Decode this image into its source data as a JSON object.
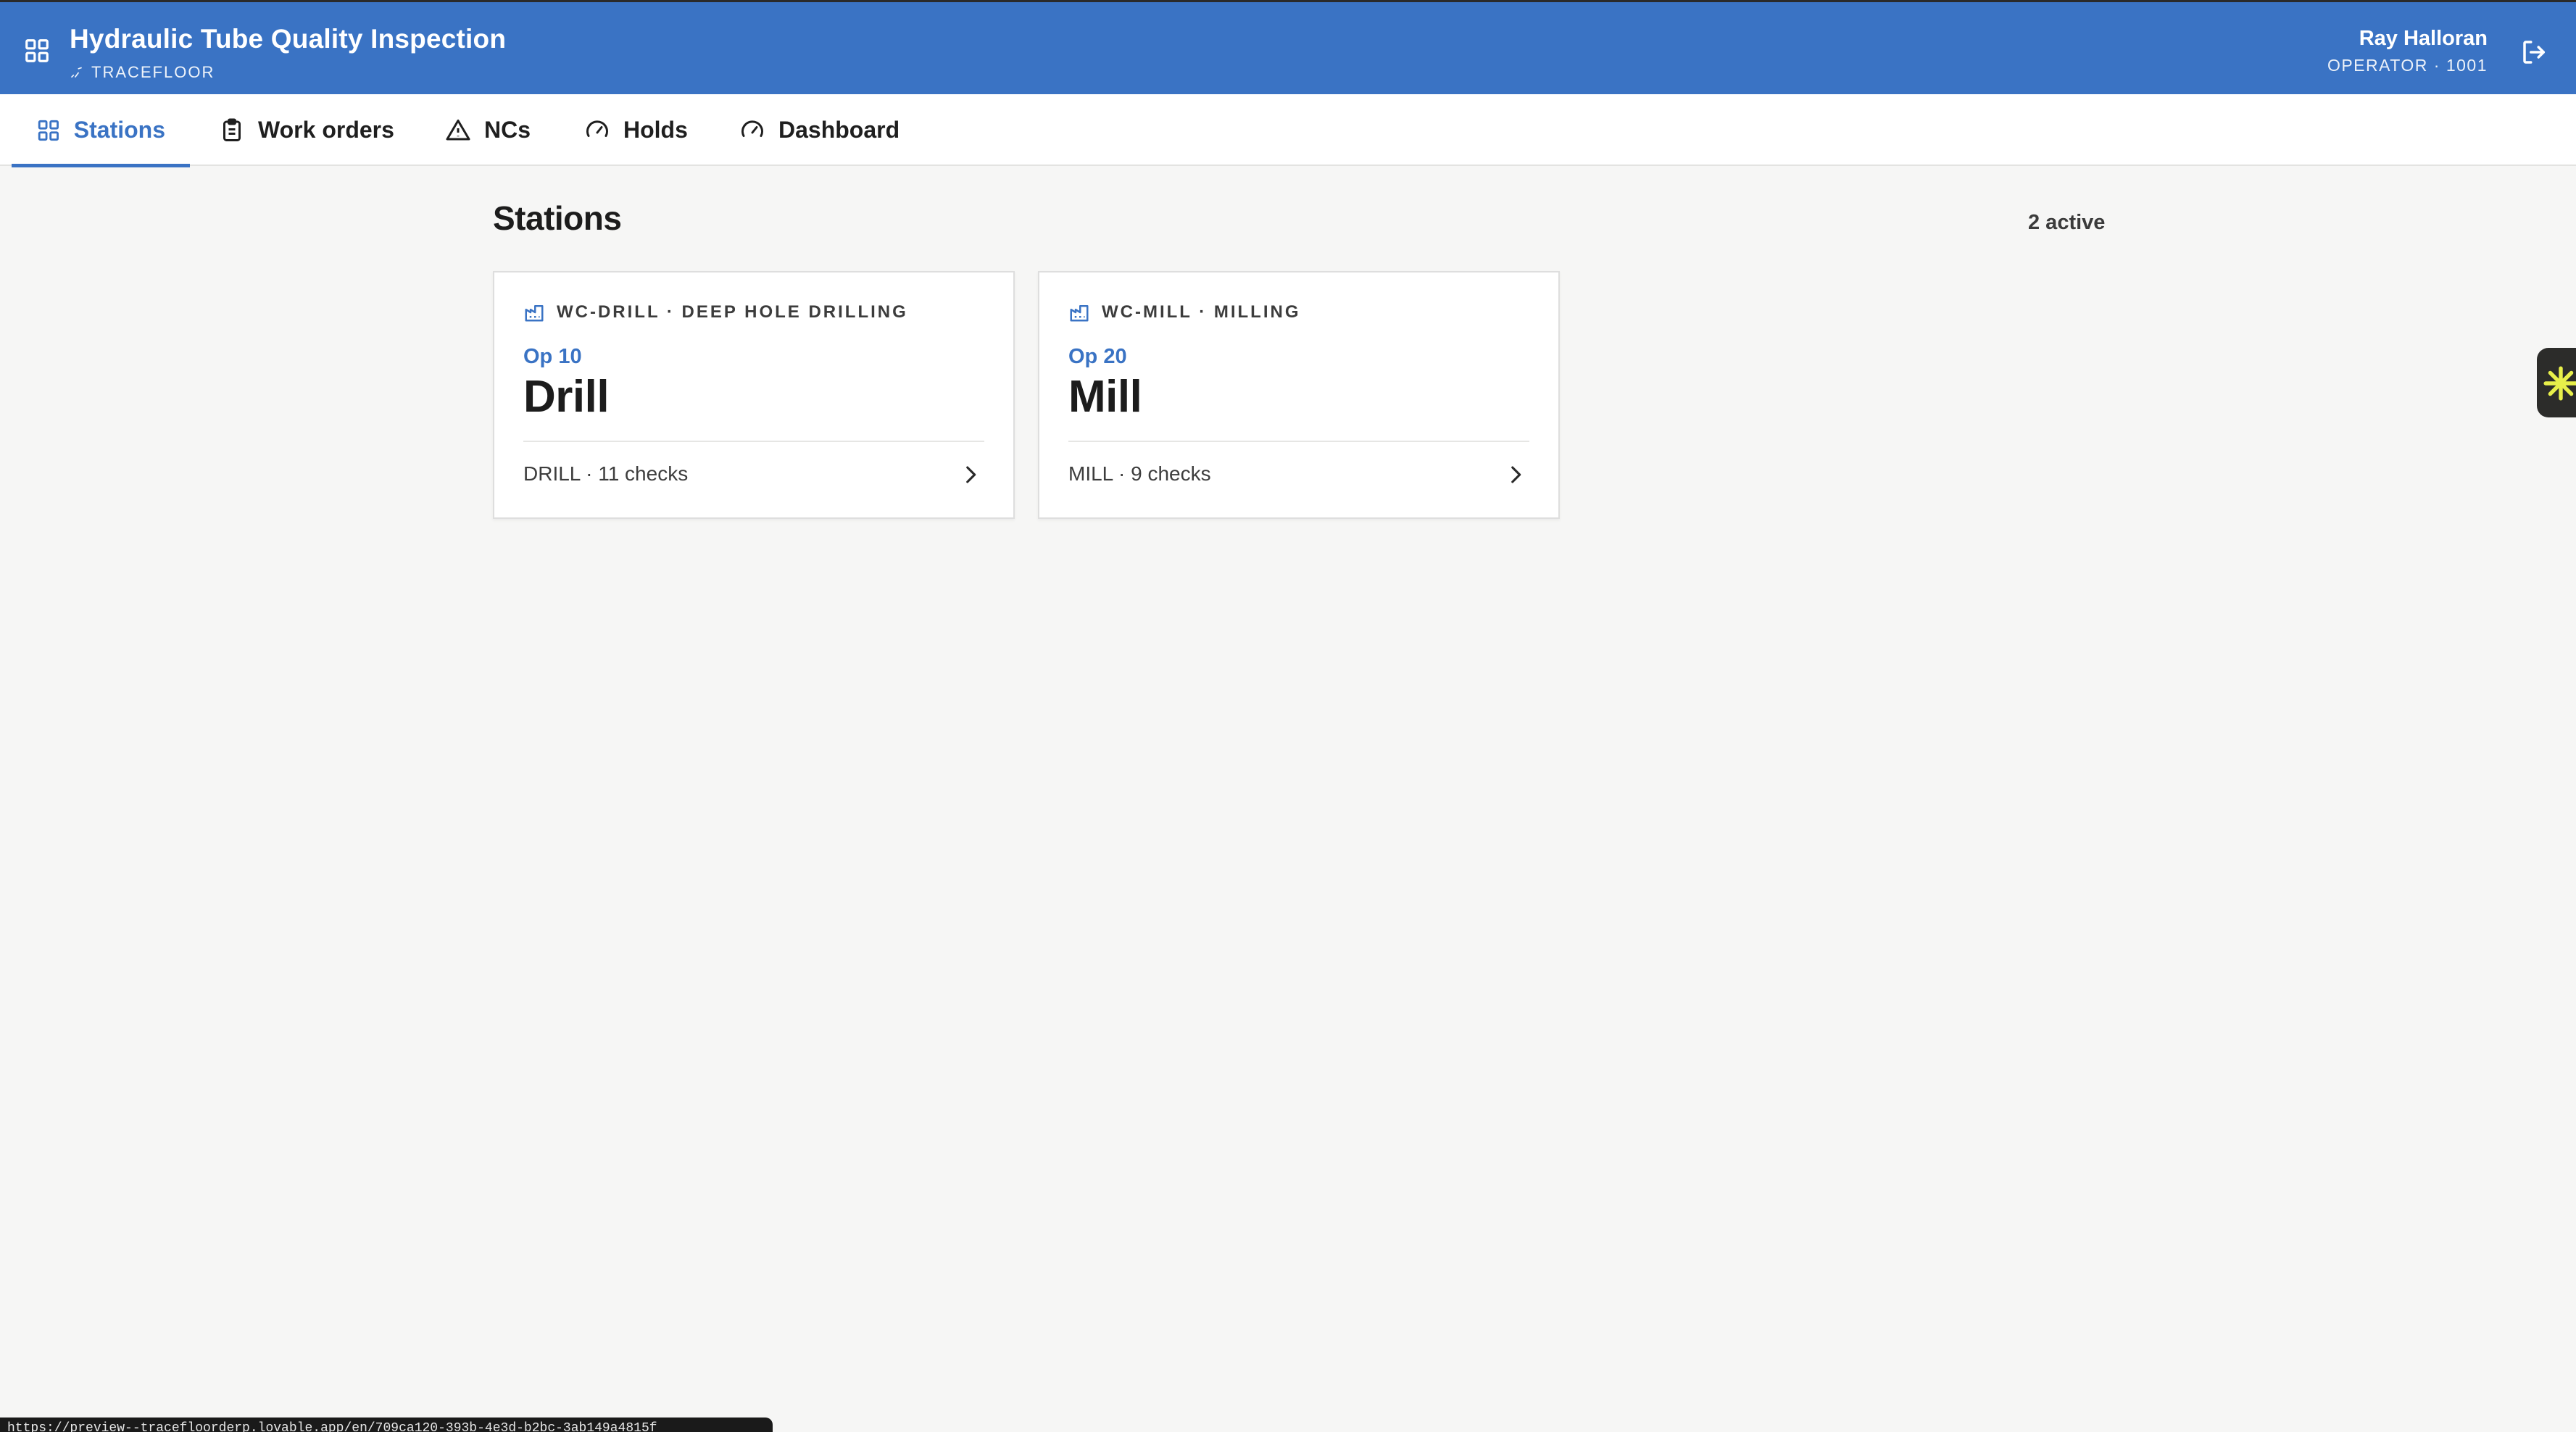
{
  "header": {
    "title": "Hydraulic Tube Quality Inspection",
    "subtitle": "TRACEFLOOR",
    "user_name": "Ray Halloran",
    "user_role": "OPERATOR · 1001",
    "icons": {
      "menu": "grid-icon",
      "brand": "wave-icon",
      "logout": "logout-icon"
    },
    "accent_color": "#3a73c4"
  },
  "tabs": [
    {
      "label": "Stations",
      "icon": "grid-icon",
      "active": true
    },
    {
      "label": "Work orders",
      "icon": "clipboard-icon",
      "active": false
    },
    {
      "label": "NCs",
      "icon": "warning-icon",
      "active": false
    },
    {
      "label": "Holds",
      "icon": "gauge-icon",
      "active": false
    },
    {
      "label": "Dashboard",
      "icon": "gauge-icon",
      "active": false
    }
  ],
  "main": {
    "title": "Stations",
    "active_count": "2 active",
    "cards": [
      {
        "workcenter": "WC-DRILL · DEEP HOLE DRILLING",
        "op": "Op 10",
        "name": "Drill",
        "meta": "DRILL · 11 checks",
        "icon": "factory-icon"
      },
      {
        "workcenter": "WC-MILL · MILLING",
        "op": "Op 20",
        "name": "Mill",
        "meta": "MILL · 9 checks",
        "icon": "factory-icon"
      }
    ]
  },
  "status_bar": {
    "url": "https://preview--tracefloorderp.lovable.app/en/709ca120-393b-4e3d-b2bc-3ab149a4815f"
  }
}
